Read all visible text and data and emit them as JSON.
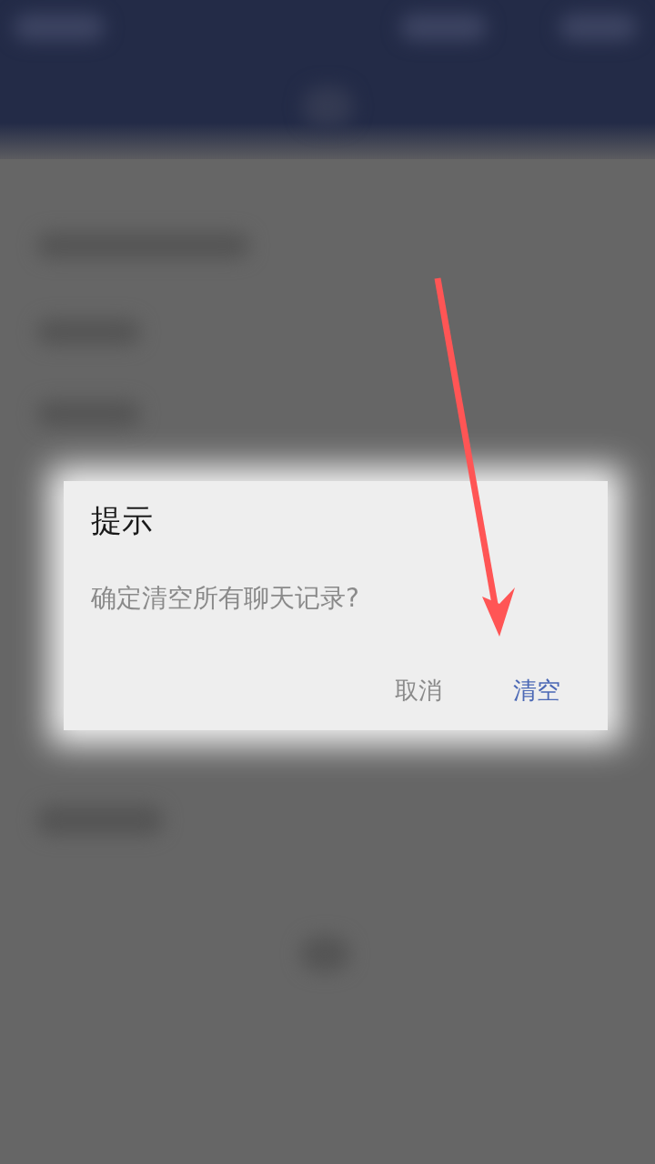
{
  "dialog": {
    "title": "提示",
    "message": "确定清空所有聊天记录?",
    "buttons": [
      {
        "label": "取消",
        "kind": "cancel"
      },
      {
        "label": "清空",
        "kind": "confirm"
      }
    ]
  }
}
